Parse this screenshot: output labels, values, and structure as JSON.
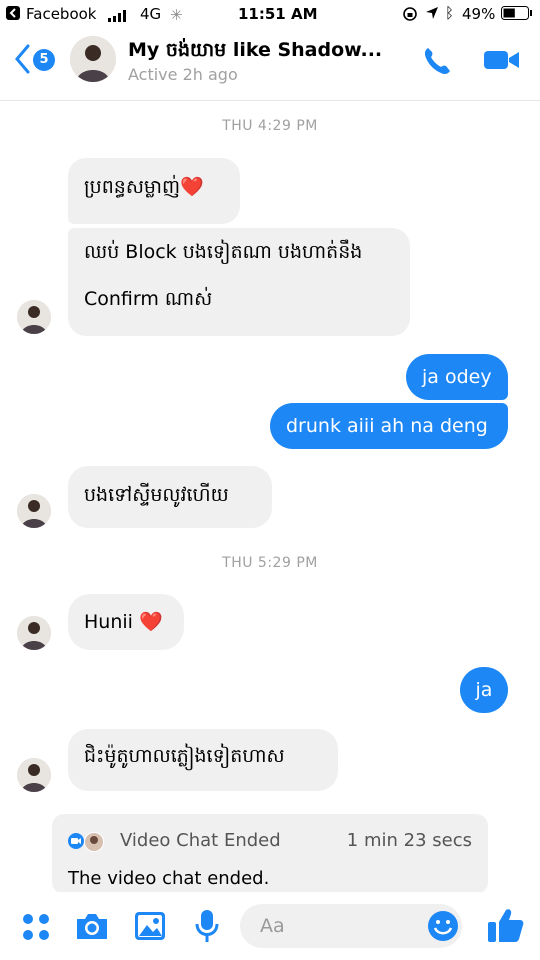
{
  "status_bar": {
    "back_app": "Facebook",
    "network": "4G",
    "time": "11:51 AM",
    "battery": "49%",
    "battery_level": 0.49
  },
  "header": {
    "back_badge": "5",
    "title": "My ចង់យាម like Shadow...",
    "subtitle": "Active 2h ago",
    "accent_color": "#1d87f5"
  },
  "messages": [
    {
      "type": "timestamp",
      "text": "THU 4:29 PM"
    },
    {
      "type": "incoming",
      "text": "ប្រពន្ធសម្លាញ់❤️"
    },
    {
      "type": "incoming",
      "lines": [
        "ឈប់ Block បងទៀតណា បងហាត់នឹង",
        "Confirm ណាស់"
      ]
    },
    {
      "type": "outgoing",
      "text": "ja odey"
    },
    {
      "type": "outgoing",
      "text": "drunk aiii ah na deng"
    },
    {
      "type": "incoming",
      "text": "បងទៅស្ទីមលូវហើយ"
    },
    {
      "type": "timestamp",
      "text": "THU 5:29 PM"
    },
    {
      "type": "incoming",
      "text": "Hunii ❤️"
    },
    {
      "type": "outgoing",
      "text": "ja"
    },
    {
      "type": "incoming",
      "text": "ជិះម៉ូតូហាលភ្លៀងទៀតហាស"
    }
  ],
  "video_chat": {
    "title": "Video Chat Ended",
    "duration": "1 min 23 secs",
    "body": "The video chat ended."
  },
  "composer": {
    "placeholder": "Aa"
  }
}
